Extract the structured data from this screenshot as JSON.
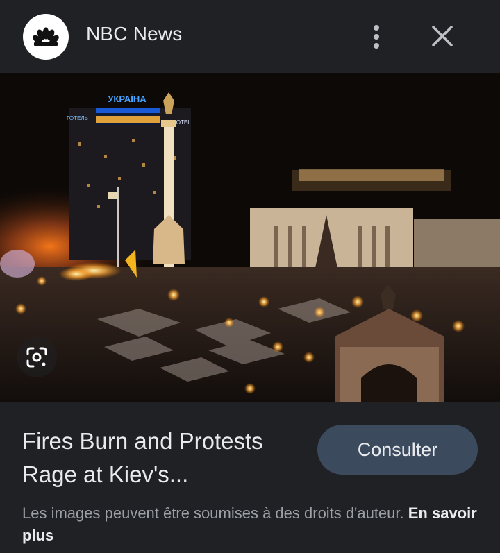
{
  "header": {
    "source_name": "NBC News",
    "logo_icon": "nbc-peacock-icon",
    "more_icon": "more-vert-icon",
    "close_icon": "close-icon"
  },
  "image": {
    "lens_icon": "google-lens-icon",
    "signs": {
      "hotel_top": "УКРАЇНА",
      "hotel_left": "ГОТЕЛЬ",
      "hotel_right": "HOTEL"
    }
  },
  "result": {
    "title": "Fires Burn and Protests Rage at Kiev's...",
    "visit_label": "Consulter"
  },
  "footer": {
    "disclaimer": "Les images peuvent être soumises à des droits d'auteur.",
    "learn_more": "En savoir plus"
  },
  "colors": {
    "background": "#202124",
    "button": "#3c4a5e",
    "text": "#e8eaed",
    "muted": "#9aa0a6"
  }
}
